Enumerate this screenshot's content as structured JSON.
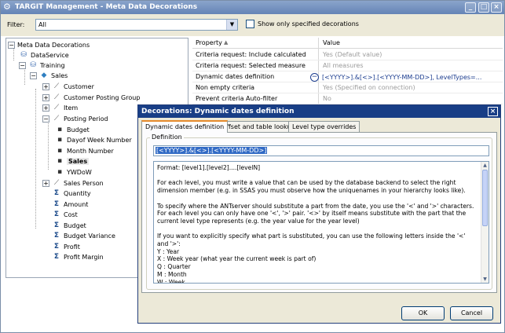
{
  "window": {
    "title": "TARGIT Management - Meta Data Decorations"
  },
  "filter": {
    "label": "Filter:",
    "value": "All",
    "show_only_label": "Show only specified decorations"
  },
  "tree": {
    "nodes": [
      {
        "label": "Meta Data Decorations",
        "icon": "none"
      },
      {
        "label": "DataService",
        "icon": "database-icon"
      },
      {
        "label": "Training",
        "icon": "database-icon"
      },
      {
        "label": "Sales",
        "icon": "cube-icon"
      },
      {
        "label": "Customer",
        "icon": "dimension-icon"
      },
      {
        "label": "Customer Posting Group",
        "icon": "dimension-icon"
      },
      {
        "label": "Item",
        "icon": "dimension-icon"
      },
      {
        "label": "Posting Period",
        "icon": "dimension-icon"
      },
      {
        "label": "Budget",
        "icon": "level-icon"
      },
      {
        "label": "Dayof Week Number",
        "icon": "level-icon"
      },
      {
        "label": "Month Number",
        "icon": "level-icon"
      },
      {
        "label": "Sales",
        "icon": "level-icon"
      },
      {
        "label": "YWDoW",
        "icon": "level-icon"
      },
      {
        "label": "Sales Person",
        "icon": "dimension-icon"
      },
      {
        "label": "Quantity",
        "icon": "measure-icon"
      },
      {
        "label": "Amount",
        "icon": "measure-icon"
      },
      {
        "label": "Cost",
        "icon": "measure-icon"
      },
      {
        "label": "Budget",
        "icon": "measure-icon"
      },
      {
        "label": "Budget Variance",
        "icon": "measure-icon"
      },
      {
        "label": "Profit",
        "icon": "measure-icon"
      },
      {
        "label": "Profit Margin",
        "icon": "measure-icon"
      }
    ]
  },
  "grid": {
    "header": {
      "property": "Property",
      "value": "Value"
    },
    "rows": [
      {
        "property": "Criteria request: Include calculated ...",
        "value": "Yes (Default value)"
      },
      {
        "property": "Criteria request: Selected measures",
        "value": "All measures"
      },
      {
        "property": "Dynamic dates definition",
        "value": "[<YYYY>].&[<>].[<YYYY-MM-DD>], LevelTypes=..."
      },
      {
        "property": "Non empty criteria",
        "value": "Yes (Specified on connection)"
      },
      {
        "property": "Prevent criteria Auto-filter",
        "value": "No"
      }
    ]
  },
  "dialog": {
    "title": "Decorations: Dynamic dates definition",
    "tabs": [
      "Dynamic dates definition",
      "Offset and table lookup",
      "Level type overrides"
    ],
    "group_title": "Definition",
    "definition_value": "[<YYYY>].&[<>].[<YYYY-MM-DD>]",
    "help_text": "Format: [level1].[level2]....[levelN]\n\nFor each level, you must write a value that can be used by the database backend to select the right dimension member (e.g. in SSAS you must observe how the uniquenames in your hierarchy looks like).\n\nTo specify where the ANTserver should substitute a part from the date, you use the '<' and '>' characters. For each level you can only have one '<', '>' pair. '<>' by itself means substitute with the part that the current level type represents (e.g. the year value for the year level)\n\nIf you want to explicitly specify what part is substituted, you can use the following letters inside the '<' and '>':\nY : Year\nX : Week year (what year the current week is part of)\nQ : Quarter\nM : Month\nW : Week\nD : Day of month",
    "ok_label": "OK",
    "cancel_label": "Cancel"
  }
}
